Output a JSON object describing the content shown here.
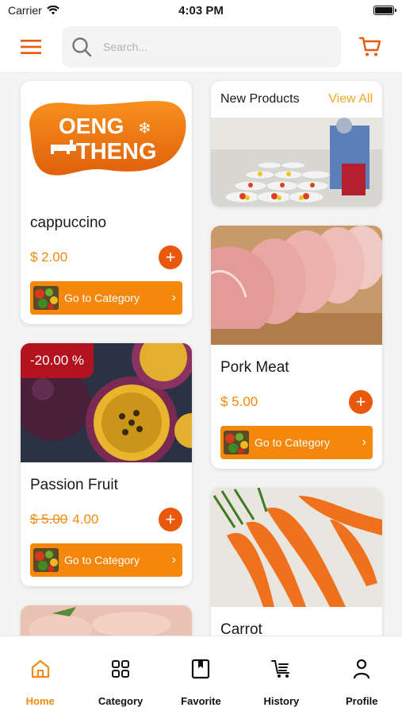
{
  "status_bar": {
    "carrier": "Carrier",
    "time": "4:03 PM"
  },
  "header": {
    "search_placeholder": "Search..."
  },
  "cards": {
    "brand_logo_text_1": "OENG",
    "brand_logo_text_2": "THENG",
    "cappuccino": {
      "name": "cappuccino",
      "price": "$ 2.00",
      "button": "Go to Category"
    },
    "passion_fruit": {
      "discount": "-20.00 %",
      "name": "Passion Fruit",
      "old_price": "$ 5.00",
      "price": "4.00",
      "button": "Go to Category"
    },
    "new_products": {
      "title": "New Products",
      "view_all": "View All"
    },
    "pork": {
      "name": "Pork Meat",
      "price": "$ 5.00",
      "button": "Go to Category"
    },
    "carrot": {
      "name": "Carrot"
    }
  },
  "tabs": [
    {
      "label": "Home",
      "icon": "home-icon",
      "active": true
    },
    {
      "label": "Category",
      "icon": "grid-icon",
      "active": false
    },
    {
      "label": "Favorite",
      "icon": "bookmark-icon",
      "active": false
    },
    {
      "label": "History",
      "icon": "cart-list-icon",
      "active": false
    },
    {
      "label": "Profile",
      "icon": "user-icon",
      "active": false
    }
  ],
  "colors": {
    "accent": "#f5870a",
    "accent_dark": "#e8590c",
    "discount": "#b3131e"
  }
}
